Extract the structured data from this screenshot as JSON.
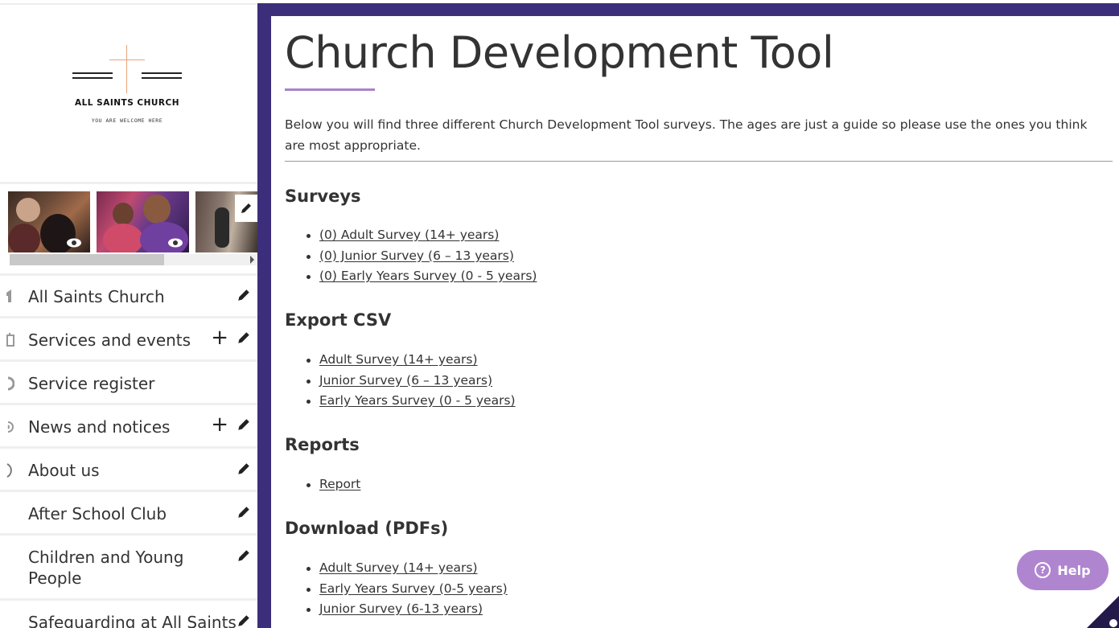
{
  "sidebar": {
    "logo": {
      "name": "ALL SAINTS CHURCH",
      "tagline": "YOU ARE WELCOME HERE"
    },
    "gallery": {
      "thumbnails": [
        "photo-thumbnail",
        "photo-thumbnail",
        "photo-thumbnail"
      ]
    },
    "items": [
      {
        "label": "All Saints Church"
      },
      {
        "label": "Services and events"
      },
      {
        "label": "Service register"
      },
      {
        "label": "News and notices"
      },
      {
        "label": "About us"
      },
      {
        "label": "After School Club"
      },
      {
        "label": "Children and Young People"
      },
      {
        "label": "Safeguarding at All Saints"
      }
    ]
  },
  "main": {
    "title": "Church Development Tool",
    "intro": "Below you will find three different Church Development Tool surveys. The ages are just a guide so please use the ones you think are most appropriate.",
    "sections": {
      "surveys": {
        "title": "Surveys",
        "links": [
          "(0) Adult Survey (14+ years)",
          "(0) Junior Survey (6 – 13 years)",
          "(0) Early Years Survey (0 - 5 years)"
        ]
      },
      "export": {
        "title": "Export CSV",
        "links": [
          "Adult Survey (14+ years)",
          "Junior Survey (6 – 13 years)",
          "Early Years Survey (0 - 5 years)"
        ]
      },
      "reports": {
        "title": "Reports",
        "links": [
          "Report"
        ]
      },
      "downloads": {
        "title": "Download (PDFs)",
        "links": [
          "Adult Survey (14+ years)",
          "Early Years Survey (0-5 years)",
          "Junior Survey (6-13 years)"
        ]
      }
    }
  },
  "help": {
    "label": "Help"
  },
  "colors": {
    "frame": "#3d2e7c",
    "accent": "#a882c8",
    "help": "#b085d0"
  }
}
